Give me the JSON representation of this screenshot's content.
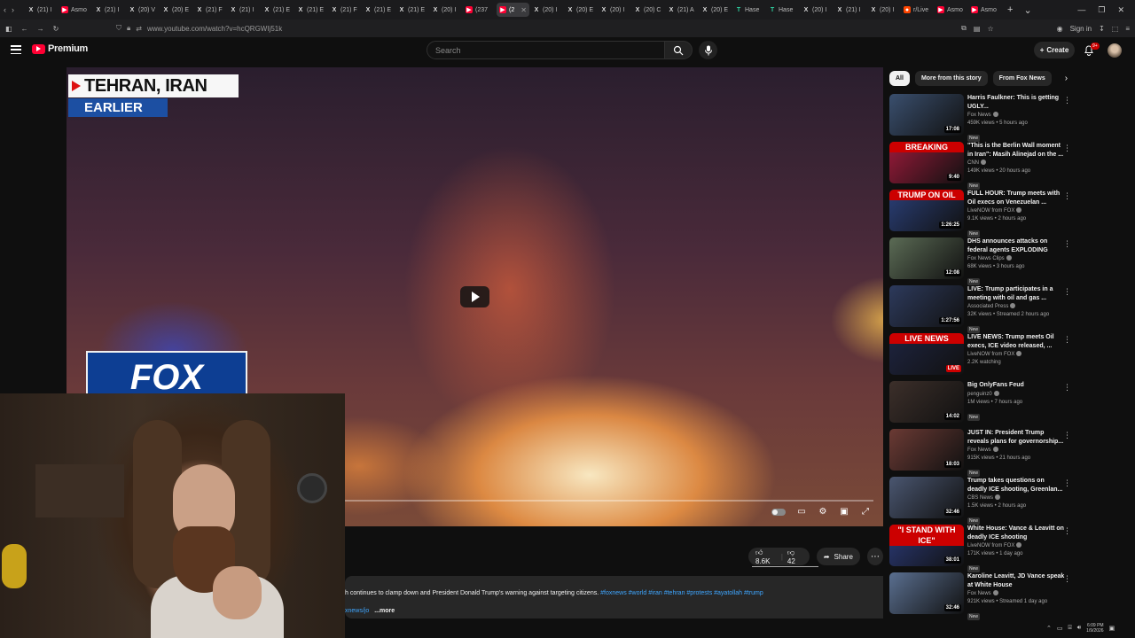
{
  "browser": {
    "tabs": [
      {
        "label": "(21) I",
        "icon": "x-icon"
      },
      {
        "label": "Asmo",
        "icon": "youtube-icon"
      },
      {
        "label": "(21) I",
        "icon": "x-icon"
      },
      {
        "label": "(20) V",
        "icon": "x-icon"
      },
      {
        "label": "(20) E",
        "icon": "x-icon"
      },
      {
        "label": "(21) F",
        "icon": "x-icon"
      },
      {
        "label": "(21) I",
        "icon": "x-icon"
      },
      {
        "label": "(21) E",
        "icon": "x-icon"
      },
      {
        "label": "(21) E",
        "icon": "x-icon"
      },
      {
        "label": "(21) F",
        "icon": "x-icon"
      },
      {
        "label": "(21) E",
        "icon": "x-icon"
      },
      {
        "label": "(21) E",
        "icon": "x-icon"
      },
      {
        "label": "(20) I",
        "icon": "x-icon"
      },
      {
        "label": "(237",
        "icon": "youtube-icon"
      },
      {
        "label": "(2",
        "icon": "youtube-icon",
        "active": true
      },
      {
        "label": "(20) I",
        "icon": "x-icon"
      },
      {
        "label": "(20) E",
        "icon": "x-icon"
      },
      {
        "label": "(20) I",
        "icon": "x-icon"
      },
      {
        "label": "(20) C",
        "icon": "x-icon"
      },
      {
        "label": "(21) A",
        "icon": "x-icon"
      },
      {
        "label": "(20) E",
        "icon": "x-icon"
      },
      {
        "label": "Hase",
        "icon": "tt-icon"
      },
      {
        "label": "Hase",
        "icon": "tt-icon"
      },
      {
        "label": "(20) I",
        "icon": "x-icon"
      },
      {
        "label": "(21) I",
        "icon": "x-icon"
      },
      {
        "label": "(20) I",
        "icon": "x-icon"
      },
      {
        "label": "r/Live",
        "icon": "reddit-icon"
      },
      {
        "label": "Asmo",
        "icon": "youtube-icon"
      },
      {
        "label": "Asmo",
        "icon": "youtube-icon"
      }
    ],
    "url": "www.youtube.com/watch?v=hcQRGWIj51k",
    "signin": "Sign in"
  },
  "youtube": {
    "logo_text": "Premium",
    "search_placeholder": "Search",
    "create_label": "Create",
    "notif_count": "9+"
  },
  "video": {
    "banner_location": "TEHRAN, IRAN",
    "banner_tag": "EARLIER",
    "network_logo": "FOX",
    "likes": "8.6K",
    "dislikes": "42",
    "share": "Share",
    "description": "h continues to clamp down and President Donald Trump's warning against targeting citizens.",
    "hashtags": "#foxnews #world #iran #tehran #protests #ayatollah #trump",
    "desc_link": "xnews/jo",
    "more": "...more",
    "progress_fraction": 0.0
  },
  "chips": [
    "All",
    "More from this story",
    "From Fox News"
  ],
  "related": [
    {
      "title": "Harris Faulkner: This is getting UGLY...",
      "channel": "Fox News",
      "meta": "459K views • 5 hours ago",
      "badge": "New",
      "duration": "17:08",
      "thumb_color": "#3a4f6e"
    },
    {
      "title": "\"This is the Berlin Wall moment in Iran\": Masih Alinejad on the ...",
      "channel": "CNN",
      "meta": "149K views • 20 hours ago",
      "badge": "New",
      "duration": "9:40",
      "thumb_color": "#9b1a3a",
      "caption": "BREAKING"
    },
    {
      "title": "FULL HOUR: Trump meets with Oil execs on Venezuelan ...",
      "channel": "LiveNOW from FOX",
      "meta": "9.1K views • 2 hours ago",
      "badge": "New",
      "duration": "1:26:25",
      "thumb_color": "#2a3f78",
      "caption": "TRUMP ON OIL"
    },
    {
      "title": "DHS announces attacks on federal agents EXPLODING",
      "channel": "Fox News Clips",
      "meta": "68K views • 3 hours ago",
      "badge": "New",
      "duration": "12:08",
      "thumb_color": "#5b6b55"
    },
    {
      "title": "LIVE: Trump participates in a meeting with oil and gas ...",
      "channel": "Associated Press",
      "meta": "32K views • Streamed 2 hours ago",
      "badge": "New",
      "duration": "1:27:56",
      "thumb_color": "#2d3a5c"
    },
    {
      "title": "LIVE NEWS: Trump meets Oil execs, ICE video released, ...",
      "channel": "LiveNOW from FOX",
      "meta": "2.2K watching",
      "badge": "",
      "duration": "LIVE",
      "thumb_color": "#1e2440",
      "caption": "LIVE NEWS"
    },
    {
      "title": "Big OnlyFans Feud",
      "channel": "penguinz0",
      "meta": "1M views • 7 hours ago",
      "badge": "New",
      "duration": "14:02",
      "thumb_color": "#3c2f2a"
    },
    {
      "title": "JUST IN: President Trump reveals plans for governorship...",
      "channel": "Fox News",
      "meta": "915K views • 21 hours ago",
      "badge": "New",
      "duration": "18:03",
      "thumb_color": "#6b3a34"
    },
    {
      "title": "Trump takes questions on deadly ICE shooting, Greenlan...",
      "channel": "CBS News",
      "meta": "1.5K views • 2 hours ago",
      "badge": "New",
      "duration": "32:46",
      "thumb_color": "#4a5670"
    },
    {
      "title": "White House: Vance & Leavitt on deadly ICE shooting",
      "channel": "LiveNOW from FOX",
      "meta": "171K views • 1 day ago",
      "badge": "New",
      "duration": "38:01",
      "thumb_color": "#2b3a78",
      "caption": "\"I STAND WITH ICE\""
    },
    {
      "title": "Karoline Leavitt, JD Vance speak at White House",
      "channel": "Fox News",
      "meta": "921K views • Streamed 1 day ago",
      "badge": "New",
      "duration": "32:46",
      "thumb_color": "#5a6f90"
    }
  ],
  "taskbar": {
    "time": "6:09 PM",
    "date": "1/9/2026"
  }
}
